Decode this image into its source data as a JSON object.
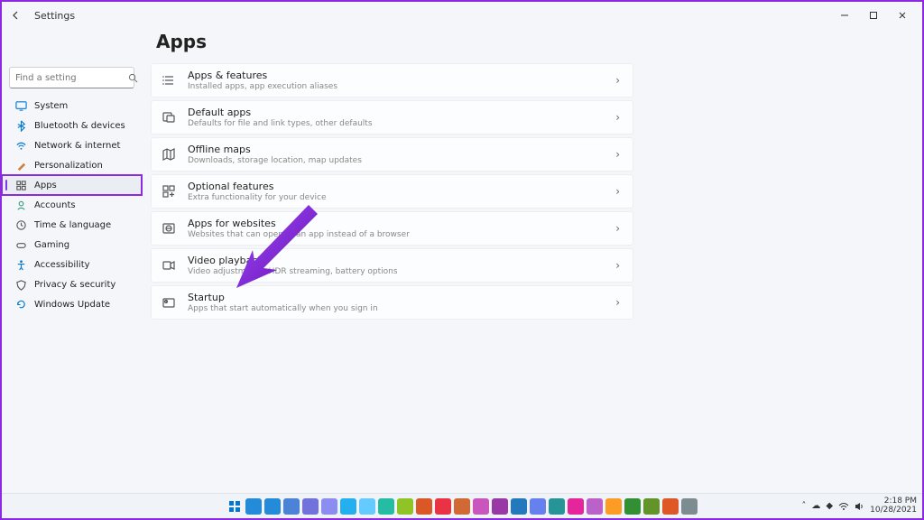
{
  "window": {
    "title": "Settings"
  },
  "search": {
    "placeholder": "Find a setting"
  },
  "sidebar": {
    "items": [
      {
        "label": "System",
        "icon": "monitor",
        "color": "#0078d4"
      },
      {
        "label": "Bluetooth & devices",
        "icon": "bluetooth",
        "color": "#0078d4"
      },
      {
        "label": "Network & internet",
        "icon": "wifi",
        "color": "#0078d4"
      },
      {
        "label": "Personalization",
        "icon": "brush",
        "color": "#d08040"
      },
      {
        "label": "Apps",
        "icon": "grid",
        "color": "#555"
      },
      {
        "label": "Accounts",
        "icon": "person",
        "color": "#3a9b7a"
      },
      {
        "label": "Time & language",
        "icon": "clock",
        "color": "#555"
      },
      {
        "label": "Gaming",
        "icon": "game",
        "color": "#555"
      },
      {
        "label": "Accessibility",
        "icon": "access",
        "color": "#0078d4"
      },
      {
        "label": "Privacy & security",
        "icon": "shield",
        "color": "#555"
      },
      {
        "label": "Windows Update",
        "icon": "update",
        "color": "#0078d4"
      }
    ],
    "active_index": 4
  },
  "page": {
    "title": "Apps",
    "cards": [
      {
        "title": "Apps & features",
        "sub": "Installed apps, app execution aliases",
        "icon": "list"
      },
      {
        "title": "Default apps",
        "sub": "Defaults for file and link types, other defaults",
        "icon": "defaults"
      },
      {
        "title": "Offline maps",
        "sub": "Downloads, storage location, map updates",
        "icon": "map"
      },
      {
        "title": "Optional features",
        "sub": "Extra functionality for your device",
        "icon": "plus-grid"
      },
      {
        "title": "Apps for websites",
        "sub": "Websites that can open in an app instead of a browser",
        "icon": "globe"
      },
      {
        "title": "Video playback",
        "sub": "Video adjustments, HDR streaming, battery options",
        "icon": "video"
      },
      {
        "title": "Startup",
        "sub": "Apps that start automatically when you sign in",
        "icon": "startup"
      }
    ]
  },
  "taskbar": {
    "time": "2:18 PM",
    "date": "10/28/2021"
  }
}
